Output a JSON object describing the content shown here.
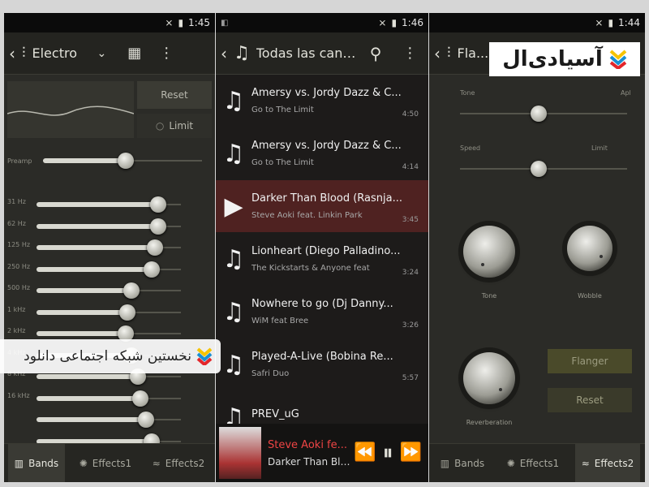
{
  "panel1": {
    "status_time": "1:45",
    "preset_name": "Electro",
    "reset_label": "Reset",
    "limit_label": "Limit",
    "preamp_label": "Preamp",
    "bands": [
      {
        "label": "31 Hz",
        "gain_fraction": 0.84
      },
      {
        "label": "62 Hz",
        "gain_fraction": 0.84
      },
      {
        "label": "125 Hz",
        "gain_fraction": 0.82
      },
      {
        "label": "250 Hz",
        "gain_fraction": 0.8
      },
      {
        "label": "500 Hz",
        "gain_fraction": 0.66
      },
      {
        "label": "1 kHz",
        "gain_fraction": 0.63
      },
      {
        "label": "2 kHz",
        "gain_fraction": 0.62
      },
      {
        "label": "4 kHz",
        "gain_fraction": 0.66
      },
      {
        "label": "8 kHz",
        "gain_fraction": 0.7
      },
      {
        "label": "16 kHz",
        "gain_fraction": 0.72
      },
      {
        "label": "",
        "gain_fraction": 0.76
      },
      {
        "label": "",
        "gain_fraction": 0.8
      },
      {
        "label": "",
        "gain_fraction": 0.82
      }
    ],
    "preamp_fraction": 0.52,
    "tabs": [
      {
        "label": "Bands"
      },
      {
        "label": "Effects1"
      },
      {
        "label": "Effects2"
      }
    ]
  },
  "panel2": {
    "status_time": "1:46",
    "title": "Todas las canci...",
    "songs": [
      {
        "title": "Amersy vs. Jordy Dazz & C...",
        "artist": "Go to The Limit",
        "duration": "4:50"
      },
      {
        "title": "Amersy vs. Jordy Dazz & C...",
        "artist": "Go to The Limit",
        "duration": "4:14"
      },
      {
        "title": "Darker Than Blood (Rasnja...",
        "artist": "Steve Aoki feat. Linkin Park",
        "duration": "3:45"
      },
      {
        "title": "Lionheart (Diego Palladino...",
        "artist": "The Kickstarts & Anyone feat",
        "duration": "3:24"
      },
      {
        "title": "Nowhere to go (Dj Danny...",
        "artist": "WiM feat Bree",
        "duration": "3:26"
      },
      {
        "title": "Played-A-Live (Bobina Re...",
        "artist": "Safri Duo",
        "duration": "5:57"
      },
      {
        "title": "PREV_uG",
        "artist": "",
        "duration": ""
      }
    ],
    "now_playing": {
      "title": "Steve Aoki fe...",
      "subtitle": "Darker Than Blo..."
    }
  },
  "panel3": {
    "status_time": "1:44",
    "title": "Fla...",
    "tone_label": "Tone",
    "tone_right": "Apl",
    "speed_label": "Speed",
    "speed_right": "Limit",
    "tone_fraction": 0.47,
    "speed_fraction": 0.47,
    "knobs": [
      {
        "label": "Tone"
      },
      {
        "label": "Wobble"
      },
      {
        "label": "Reverberation"
      }
    ],
    "flanger_label": "Flanger",
    "reset_label": "Reset",
    "tabs": [
      {
        "label": "Bands"
      },
      {
        "label": "Effects1"
      },
      {
        "label": "Effects2"
      }
    ]
  },
  "watermark": {
    "logo_text": "آسیادی‌ال",
    "network_text": "نخستین شبکه اجتماعی دانلود",
    "colors": {
      "yellow": "#f6c400",
      "blue": "#1a8fd1",
      "red": "#e3262b"
    }
  }
}
